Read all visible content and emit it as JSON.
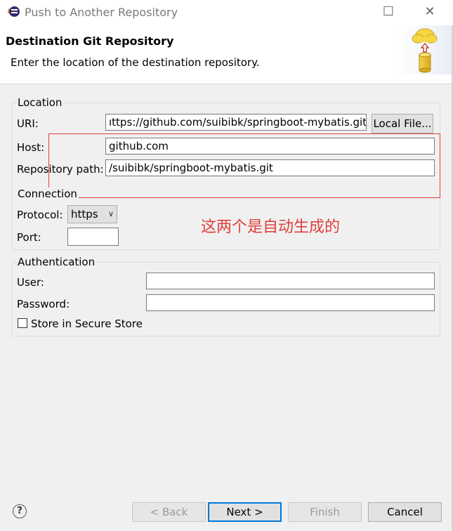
{
  "window": {
    "title": "Push to Another Repository",
    "minimize_glyph": "☐",
    "close_glyph": "✕",
    "icon": "eclipse-icon"
  },
  "header": {
    "title": "Destination Git Repository",
    "description": "Enter the location of the destination repository.",
    "art_icon": "cloud-database-icon"
  },
  "location": {
    "group_label": "Location",
    "uri_label": "URI:",
    "uri_value": "ıttps://github.com/suibibk/springboot-mybatis.git",
    "local_file_button": "Local File...",
    "host_label": "Host:",
    "host_value": "github.com",
    "repo_path_label": "Repository path:",
    "repo_path_value": "/suibibk/springboot-mybatis.git"
  },
  "connection": {
    "group_label": "Connection",
    "protocol_label": "Protocol:",
    "protocol_value": "https",
    "port_label": "Port:",
    "port_value": ""
  },
  "annotation": {
    "text": "这两个是自动生成的",
    "color": "#e0403c"
  },
  "authentication": {
    "group_label": "Authentication",
    "user_label": "User:",
    "user_value": "",
    "password_label": "Password:",
    "password_value": "",
    "secure_store_label": "Store in Secure Store"
  },
  "footer": {
    "help_glyph": "?",
    "back_button": "< Back",
    "next_button": "Next >",
    "finish_button": "Finish",
    "cancel_button": "Cancel"
  }
}
